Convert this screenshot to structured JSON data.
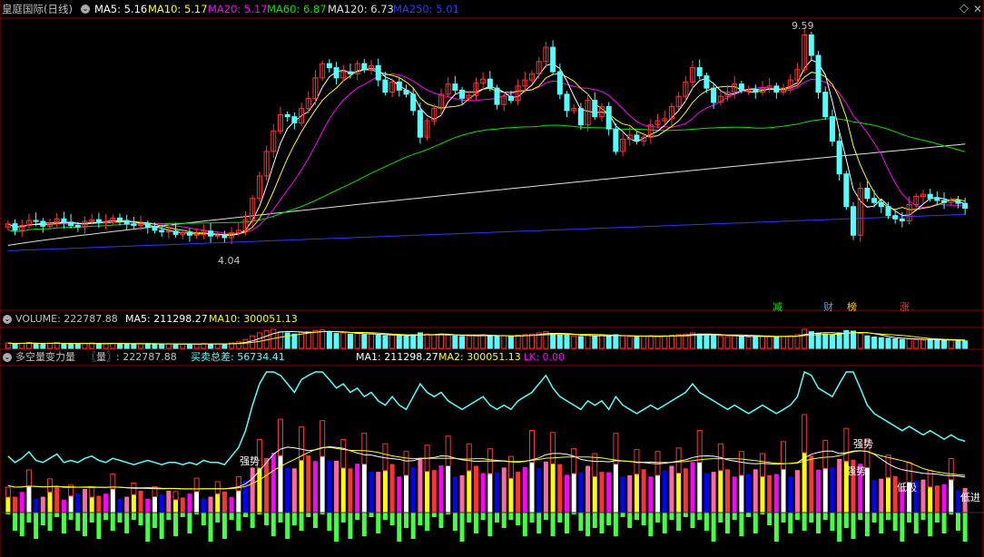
{
  "colors": {
    "up": "#ff3232",
    "down": "#54ffff",
    "ma5": "#ffffff",
    "ma10": "#ffff00",
    "ma20": "#ff00ff",
    "ma60": "#00e600",
    "ma120": "#e0e0e0",
    "ma250": "#3333ff",
    "frame": "#8b0000",
    "text": "#c0c0c0"
  },
  "header": {
    "title": "皇庭国际(日线)",
    "ma5": "MA5: 5.16",
    "ma10": "MA10: 5.17",
    "ma20": "MA20: 5.17",
    "ma60": "MA60: 6.87",
    "ma120": "MA120: 6.73",
    "ma250": "MA250: 5.01"
  },
  "volume_header": {
    "volume": "VOLUME: 222787.88",
    "ma5": "MA5: 211298.27",
    "ma10": "MA10: 300051.13"
  },
  "indicator_header": {
    "name": "多空量变力量",
    "qty": "〖量〗: 222787.88",
    "total": "买卖总差: 56734.41",
    "ma1": "MA1: 211298.27",
    "ma2": "MA2: 300051.13",
    "lk": "LK: 0.00"
  },
  "annotations": {
    "high": "9.59",
    "low": "4.04",
    "badge_jian": "减",
    "badge_cai": "财",
    "badge_bang": "榜",
    "badge_zhang": "涨",
    "strong1": "强势",
    "strong2": "强势",
    "strong3": "强势",
    "dijin": "低进",
    "dixi": "低吸"
  },
  "chart_data": [
    {
      "type": "candlestick",
      "title": "皇庭国际(日线)",
      "highest": 9.59,
      "lowest": 4.04,
      "legend": [
        "MA5: 5.16",
        "MA10: 5.17",
        "MA20: 5.17",
        "MA60: 6.87",
        "MA120: 6.73",
        "MA250: 5.01"
      ],
      "close": [
        4.78,
        4.62,
        4.74,
        4.86,
        4.84,
        4.72,
        4.8,
        4.9,
        4.82,
        4.74,
        4.7,
        4.84,
        4.88,
        4.8,
        4.82,
        4.92,
        4.86,
        4.78,
        4.74,
        4.78,
        4.7,
        4.62,
        4.58,
        4.6,
        4.52,
        4.56,
        4.5,
        4.52,
        4.6,
        4.48,
        4.5,
        4.44,
        4.56,
        4.62,
        4.88,
        5.4,
        5.95,
        6.55,
        7.05,
        7.45,
        7.4,
        7.25,
        7.6,
        7.85,
        8.35,
        8.7,
        8.6,
        8.35,
        8.5,
        8.45,
        8.7,
        8.55,
        8.65,
        8.3,
        8.0,
        8.25,
        8.05,
        7.95,
        7.55,
        6.9,
        7.3,
        7.6,
        7.95,
        8.2,
        8.05,
        7.85,
        7.92,
        8.22,
        8.32,
        8.1,
        7.7,
        7.9,
        7.8,
        8.15,
        8.3,
        8.45,
        8.75,
        9.1,
        8.5,
        7.95,
        7.55,
        7.6,
        7.2,
        7.8,
        7.4,
        7.65,
        7.1,
        6.55,
        6.85,
        6.95,
        6.8,
        6.9,
        7.2,
        7.3,
        7.35,
        7.65,
        7.9,
        8.25,
        8.6,
        8.4,
        8.1,
        7.75,
        7.9,
        8.0,
        8.2,
        8.05,
        8.05,
        8.0,
        8.1,
        8.15,
        8.0,
        8.1,
        8.3,
        8.55,
        9.4,
        8.9,
        8.0,
        7.4,
        6.8,
        6.0,
        5.2,
        4.5,
        5.65,
        5.4,
        5.3,
        5.2,
        4.98,
        4.9,
        4.85,
        5.25,
        5.45,
        5.5,
        5.4,
        5.35,
        5.3,
        5.35,
        5.28,
        5.16
      ],
      "open": [
        4.7,
        4.78,
        4.62,
        4.74,
        4.86,
        4.84,
        4.72,
        4.8,
        4.9,
        4.82,
        4.74,
        4.7,
        4.84,
        4.88,
        4.8,
        4.82,
        4.92,
        4.86,
        4.78,
        4.74,
        4.78,
        4.7,
        4.62,
        4.58,
        4.6,
        4.52,
        4.56,
        4.5,
        4.52,
        4.6,
        4.48,
        4.5,
        4.44,
        4.56,
        4.62,
        4.88,
        5.4,
        5.95,
        6.55,
        7.05,
        7.45,
        7.4,
        7.25,
        7.6,
        7.85,
        8.35,
        8.7,
        8.6,
        8.35,
        8.5,
        8.45,
        8.7,
        8.55,
        8.65,
        8.3,
        8.0,
        8.25,
        8.05,
        7.95,
        7.55,
        6.9,
        7.3,
        7.6,
        7.95,
        8.2,
        8.05,
        7.85,
        7.92,
        8.22,
        8.32,
        8.1,
        7.7,
        7.9,
        7.8,
        8.15,
        8.3,
        8.45,
        8.75,
        9.1,
        8.5,
        7.95,
        7.55,
        7.6,
        7.2,
        7.8,
        7.4,
        7.65,
        7.1,
        6.55,
        6.85,
        6.95,
        6.8,
        6.9,
        7.2,
        7.3,
        7.35,
        7.65,
        7.9,
        8.25,
        8.6,
        8.4,
        8.1,
        7.75,
        7.9,
        8.0,
        8.2,
        8.05,
        8.05,
        8.0,
        8.1,
        8.15,
        8.0,
        8.1,
        8.3,
        8.55,
        9.4,
        8.9,
        8.0,
        7.4,
        6.8,
        6.0,
        5.2,
        4.5,
        5.65,
        5.4,
        5.3,
        5.2,
        4.98,
        4.9,
        4.85,
        5.25,
        5.45,
        5.5,
        5.4,
        5.35,
        5.3,
        5.35,
        5.28
      ],
      "ma120_start": 4.25,
      "ma120_end": 6.73,
      "ma250_start": 4.12,
      "ma250_end": 5.01,
      "ma60_start": 4.4,
      "ma60_end": 6.87
    },
    {
      "type": "bar",
      "title": "VOLUME",
      "legend": [
        "VOLUME: 222787.88",
        "MA5: 211298.27",
        "MA10: 300051.13"
      ],
      "values": [
        180,
        150,
        170,
        200,
        160,
        150,
        170,
        190,
        150,
        160,
        150,
        170,
        180,
        160,
        150,
        170,
        160,
        150,
        140,
        150,
        160,
        150,
        140,
        150,
        150,
        140,
        150,
        140,
        160,
        150,
        150,
        140,
        180,
        220,
        300,
        420,
        520,
        600,
        640,
        560,
        520,
        480,
        540,
        560,
        600,
        620,
        540,
        500,
        520,
        480,
        500,
        460,
        480,
        440,
        420,
        460,
        420,
        400,
        460,
        520,
        480,
        460,
        480,
        440,
        420,
        400,
        420,
        440,
        460,
        420,
        400,
        420,
        400,
        440,
        460,
        480,
        520,
        560,
        500,
        460,
        440,
        420,
        400,
        440,
        420,
        440,
        400,
        460,
        420,
        400,
        380,
        400,
        420,
        400,
        420,
        440,
        460,
        480,
        520,
        480,
        460,
        440,
        420,
        400,
        420,
        400,
        380,
        400,
        420,
        400,
        380,
        400,
        420,
        460,
        640,
        560,
        500,
        480,
        460,
        520,
        600,
        580,
        500,
        420,
        380,
        360,
        340,
        320,
        300,
        320,
        300,
        280,
        300,
        280,
        260,
        280,
        260,
        250
      ]
    }
  ]
}
